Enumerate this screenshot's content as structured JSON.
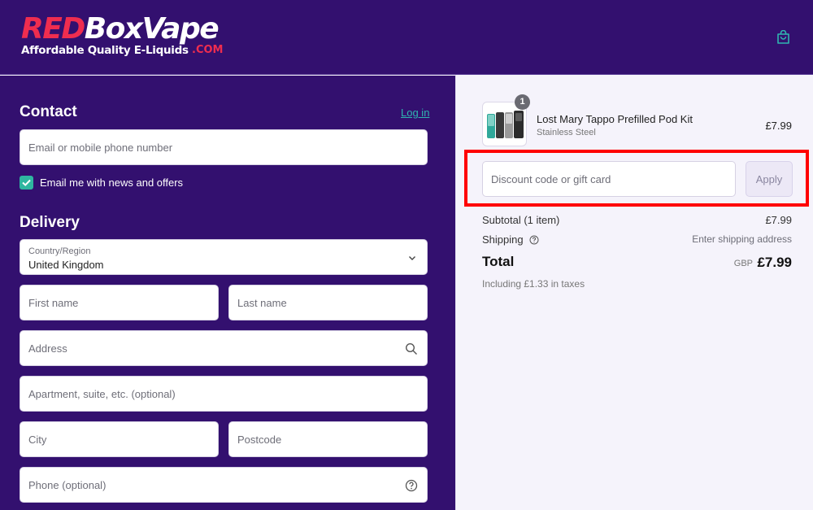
{
  "brand": {
    "logo_red": "RED",
    "logo_white": "BoxVape",
    "tagline": "Affordable Quality E-Liquids",
    "domain": ".COM",
    "colors": {
      "primary": "#33106f",
      "accent": "#ef2d4f",
      "link": "#2fb6b0"
    }
  },
  "header": {
    "cart_icon": "shopping-bag-icon"
  },
  "contact": {
    "title": "Contact",
    "login_label": "Log in",
    "email_placeholder": "Email or mobile phone number",
    "newsletter_label": "Email me with news and offers",
    "newsletter_checked": true
  },
  "delivery": {
    "title": "Delivery",
    "country_label": "Country/Region",
    "country_value": "United Kingdom",
    "first_name_placeholder": "First name",
    "last_name_placeholder": "Last name",
    "address_placeholder": "Address",
    "apartment_placeholder": "Apartment, suite, etc. (optional)",
    "city_placeholder": "City",
    "postcode_placeholder": "Postcode",
    "phone_placeholder": "Phone (optional)"
  },
  "order": {
    "item": {
      "quantity": "1",
      "name": "Lost Mary Tappo Prefilled Pod Kit",
      "variant": "Stainless Steel",
      "price": "£7.99"
    },
    "discount_placeholder": "Discount code or gift card",
    "apply_label": "Apply",
    "subtotal_label": "Subtotal (1 item)",
    "subtotal_value": "£7.99",
    "shipping_label": "Shipping",
    "shipping_value": "Enter shipping address",
    "total_label": "Total",
    "total_currency": "GBP",
    "total_value": "£7.99",
    "tax_note": "Including £1.33 in taxes"
  }
}
